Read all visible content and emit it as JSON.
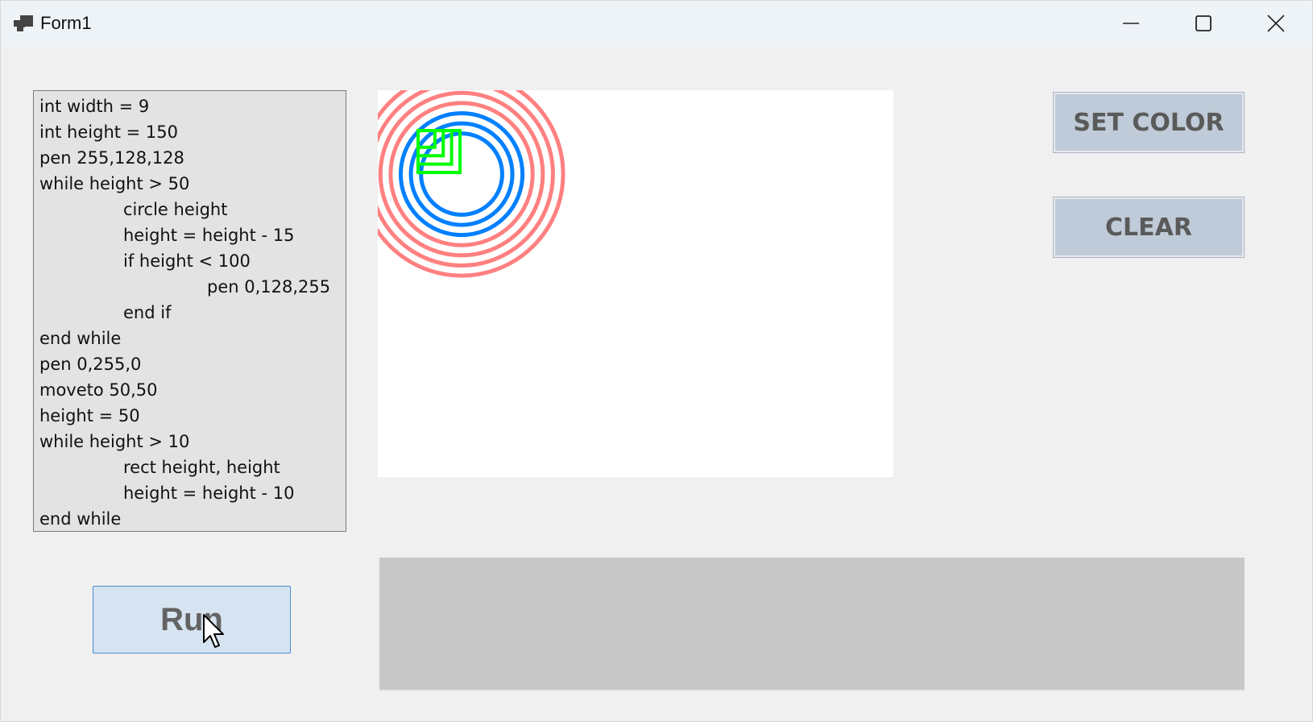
{
  "window": {
    "title": "Form1",
    "controls": {
      "minimize_icon": "minimize-icon",
      "maximize_icon": "maximize-icon",
      "close_icon": "close-icon"
    }
  },
  "code_editor": {
    "lines": [
      {
        "text": "int width = 9",
        "indent": 0
      },
      {
        "text": "int height = 150",
        "indent": 0
      },
      {
        "text": "pen 255,128,128",
        "indent": 0
      },
      {
        "text": "while height > 50",
        "indent": 0
      },
      {
        "text": "circle height",
        "indent": 1
      },
      {
        "text": "height = height - 15",
        "indent": 1
      },
      {
        "text": "if height < 100",
        "indent": 1
      },
      {
        "text": "pen 0,128,255",
        "indent": 2
      },
      {
        "text": "end if",
        "indent": 1
      },
      {
        "text": "end while",
        "indent": 0
      },
      {
        "text": "pen 0,255,0",
        "indent": 0
      },
      {
        "text": "moveto 50,50",
        "indent": 0
      },
      {
        "text": "height = 50",
        "indent": 0
      },
      {
        "text": "while height > 10",
        "indent": 0
      },
      {
        "text": "rect height, height",
        "indent": 1
      },
      {
        "text": "height = height - 10",
        "indent": 1
      },
      {
        "text": "end while",
        "indent": 0
      }
    ]
  },
  "drawing": {
    "background": "#ffffff",
    "colors": {
      "red_pen": "#ff8080",
      "blue_pen": "#0080ff",
      "green_pen": "#00ff00"
    },
    "circles": [
      {
        "radius": 150,
        "color": "#ff8080"
      },
      {
        "radius": 135,
        "color": "#ff8080"
      },
      {
        "radius": 120,
        "color": "#ff8080"
      },
      {
        "radius": 105,
        "color": "#ff8080"
      },
      {
        "radius": 90,
        "color": "#0080ff"
      },
      {
        "radius": 75,
        "color": "#0080ff"
      },
      {
        "radius": 60,
        "color": "#0080ff"
      }
    ],
    "rects": [
      {
        "x": 50,
        "y": 50,
        "size": 50,
        "color": "#00ff00"
      },
      {
        "x": 50,
        "y": 50,
        "size": 40,
        "color": "#00ff00"
      },
      {
        "x": 50,
        "y": 50,
        "size": 30,
        "color": "#00ff00"
      },
      {
        "x": 50,
        "y": 50,
        "size": 20,
        "color": "#00ff00"
      }
    ]
  },
  "buttons": {
    "set_color": "SET COLOR",
    "clear": "CLEAR",
    "run": "Run"
  }
}
